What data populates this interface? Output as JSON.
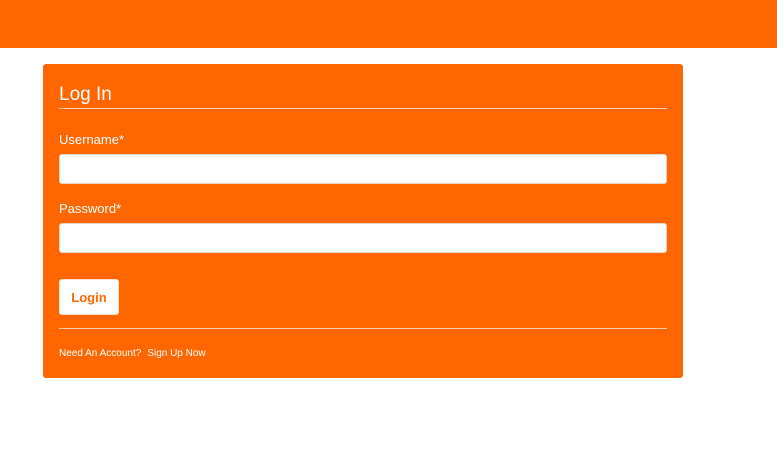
{
  "header": {
    "color": "#ff6600"
  },
  "login_form": {
    "title": "Log In",
    "username_label": "Username*",
    "username_value": "",
    "password_label": "Password*",
    "password_value": "",
    "submit_label": "Login",
    "footer_prompt": "Need An Account?",
    "signup_link": "Sign Up Now"
  },
  "colors": {
    "brand": "#ff6600",
    "button_bg": "#ffffff",
    "text_on_brand": "#ffffff"
  }
}
